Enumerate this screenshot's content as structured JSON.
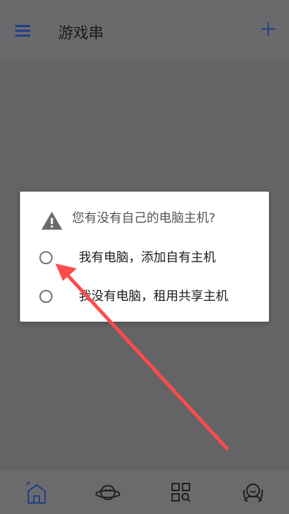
{
  "header": {
    "title": "游戏串",
    "menu_icon": "hamburger-menu-icon",
    "add_icon": "plus-icon",
    "accent_color": "#1f3f86"
  },
  "dialog": {
    "title": "您有没有自己的电脑主机?",
    "warning_icon": "warning-triangle-icon",
    "options": [
      {
        "label": "我有电脑，添加自有主机"
      },
      {
        "label": "我没有电脑，租用共享主机"
      }
    ]
  },
  "bottom_nav": {
    "items": [
      {
        "icon": "home-icon"
      },
      {
        "icon": "planet-icon"
      },
      {
        "icon": "grid-search-icon"
      },
      {
        "icon": "user-profile-icon"
      }
    ]
  }
}
